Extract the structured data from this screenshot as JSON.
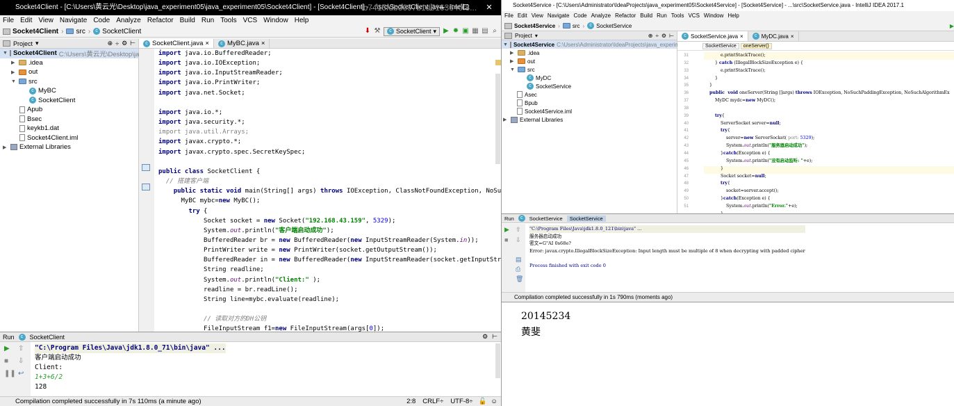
{
  "left": {
    "title": "Socket4Client - [C:\\Users\\黄云光\\Desktop\\java_experiment05\\java_experiment05\\Socket4Client] - [Socket4Client] - ...\\src\\SocketClient.java - Intell...",
    "overlay_text": "lb7415fdb3697b1d5163640f8...",
    "menu": [
      "File",
      "Edit",
      "View",
      "Navigate",
      "Code",
      "Analyze",
      "Refactor",
      "Build",
      "Run",
      "Tools",
      "VCS",
      "Window",
      "Help"
    ],
    "breadcrumb": {
      "project": "Socket4Client",
      "folder": "src",
      "file": "SocketClient"
    },
    "run_config": "SocketClient",
    "project_panel": {
      "title": "Project",
      "root": "Socket4Client",
      "root_path": "C:\\Users\\黄云光\\Desktop\\ja",
      "items": [
        {
          "label": ".idea",
          "type": "folder",
          "indent": 1
        },
        {
          "label": "out",
          "type": "folder-orange",
          "indent": 1
        },
        {
          "label": "src",
          "type": "folder-blue",
          "indent": 1
        },
        {
          "label": "MyBC",
          "type": "class",
          "indent": 2
        },
        {
          "label": "SocketClient",
          "type": "class",
          "indent": 2
        },
        {
          "label": "Apub",
          "type": "file",
          "indent": 1
        },
        {
          "label": "Bsec",
          "type": "file",
          "indent": 1
        },
        {
          "label": "keykb1.dat",
          "type": "file",
          "indent": 1
        },
        {
          "label": "Socket4Client.iml",
          "type": "file",
          "indent": 1
        },
        {
          "label": "External Libraries",
          "type": "lib",
          "indent": 0
        }
      ]
    },
    "tabs": [
      "SocketClient.java",
      "MyBC.java"
    ],
    "run_panel": {
      "title": "Run",
      "config": "SocketClient",
      "lines": [
        "\"C:\\Program Files\\Java\\jdk1.8.0_71\\bin\\java\" ...",
        "客户端启动成功",
        "Client:",
        "1+3+6/2",
        "128"
      ]
    },
    "status": {
      "message": "Compilation completed successfully in 7s 110ms (a minute ago)",
      "pos": "2:8",
      "crlf": "CRLF÷",
      "enc": "UTF-8÷"
    }
  },
  "right": {
    "title": "Socket4Service - [C:\\Users\\Administrator\\IdeaProjects\\java_experiment05\\Socket4Service] - [Socket4Service] - ...\\src\\SocketService.java - IntelliJ IDEA 2017.1",
    "menu": [
      "File",
      "Edit",
      "View",
      "Navigate",
      "Code",
      "Analyze",
      "Refactor",
      "Build",
      "Run",
      "Tools",
      "VCS",
      "Window",
      "Help"
    ],
    "breadcrumb": {
      "project": "Socket4Service",
      "folder": "src",
      "file": "SocketService"
    },
    "project_panel": {
      "title": "Project",
      "root": "Socket4Service",
      "root_path": "C:\\Users\\Administrator\\IdeaProjects\\java_experiment",
      "items": [
        {
          "label": ".idea",
          "type": "folder",
          "indent": 1
        },
        {
          "label": "out",
          "type": "folder-orange",
          "indent": 1
        },
        {
          "label": "src",
          "type": "folder-blue",
          "indent": 1
        },
        {
          "label": "MyDC",
          "type": "class",
          "indent": 2
        },
        {
          "label": "SocketService",
          "type": "class",
          "indent": 2
        },
        {
          "label": "Asec",
          "type": "file",
          "indent": 1
        },
        {
          "label": "Bpub",
          "type": "file",
          "indent": 1
        },
        {
          "label": "Socket4Service.iml",
          "type": "file",
          "indent": 1
        },
        {
          "label": "External Libraries",
          "type": "lib",
          "indent": 0
        }
      ]
    },
    "tabs": [
      "SocketService.java",
      "MyDC.java"
    ],
    "crumbs": [
      "SocketService",
      "oneServer()"
    ],
    "line_numbers": [
      "31",
      "32",
      "33",
      "34",
      "35",
      "36",
      "37",
      "38",
      "39",
      "40",
      "41",
      "42",
      "43",
      "44",
      "45",
      "46",
      "47",
      "48",
      "49",
      "50",
      "51"
    ],
    "run_panel": {
      "title": "Run",
      "tabs": [
        "SocketService",
        "SocketService"
      ],
      "lines": [
        "\"C:\\Program Files\\Java\\jdk1.8.0_121\\bin\\java\" ...",
        "服务器启动成功",
        "密文=G\"AI  0s68e?",
        "Error: javax.crypto.IllegalBlockSizeException: Input length must be multiple of 8 when decrypting with padded cipher",
        "",
        "Process finished with exit code 0"
      ]
    },
    "status": "Compilation completed successfully in 1s 790ms (moments ago)"
  },
  "note": {
    "line1": "20145234",
    "line2": "黄斐"
  }
}
